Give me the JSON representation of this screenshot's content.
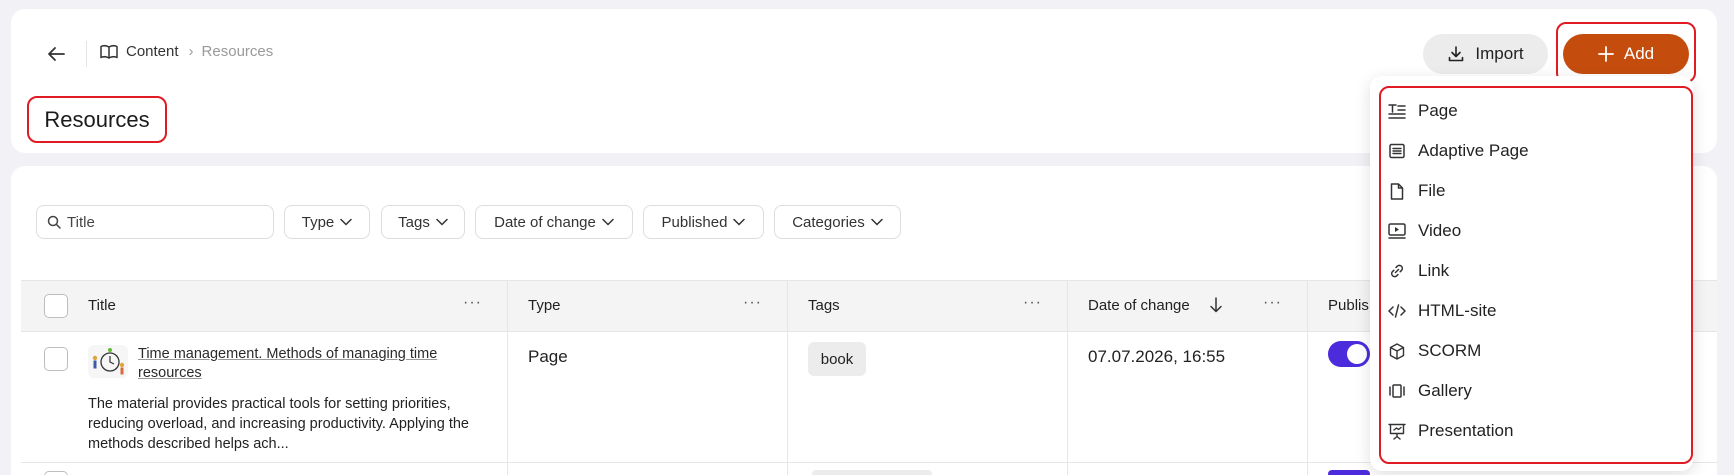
{
  "breadcrumb": {
    "root_label": "Content",
    "current_label": "Resources"
  },
  "page": {
    "title": "Resources"
  },
  "toolbar": {
    "import_label": "Import",
    "add_label": "Add"
  },
  "filters": {
    "search_placeholder": "Title",
    "items": [
      {
        "label": "Type"
      },
      {
        "label": "Tags"
      },
      {
        "label": "Date of change"
      },
      {
        "label": "Published"
      },
      {
        "label": "Categories"
      }
    ]
  },
  "table": {
    "columns": {
      "title": "Title",
      "type": "Type",
      "tags": "Tags",
      "date": "Date of change",
      "published": "Publis"
    },
    "rows": [
      {
        "title": "Time management. Methods of managing time resources",
        "description": "The material provides practical tools for setting priorities, reducing overload, and increasing productivity. Applying the methods described helps ach...",
        "type": "Page",
        "tag": "book",
        "date": "07.07.2026, 16:55",
        "published": true
      }
    ]
  },
  "add_menu": {
    "items": [
      {
        "label": "Page",
        "icon": "page-text-icon"
      },
      {
        "label": "Adaptive Page",
        "icon": "adaptive-page-icon"
      },
      {
        "label": "File",
        "icon": "file-icon"
      },
      {
        "label": "Video",
        "icon": "video-icon"
      },
      {
        "label": "Link",
        "icon": "link-icon"
      },
      {
        "label": "HTML-site",
        "icon": "code-icon"
      },
      {
        "label": "SCORM",
        "icon": "cube-icon"
      },
      {
        "label": "Gallery",
        "icon": "gallery-icon"
      },
      {
        "label": "Presentation",
        "icon": "presentation-icon"
      }
    ]
  },
  "colors": {
    "accent": "#c44d0e",
    "highlight_frame": "#e01b24",
    "toggle_on": "#4b2bdb"
  }
}
